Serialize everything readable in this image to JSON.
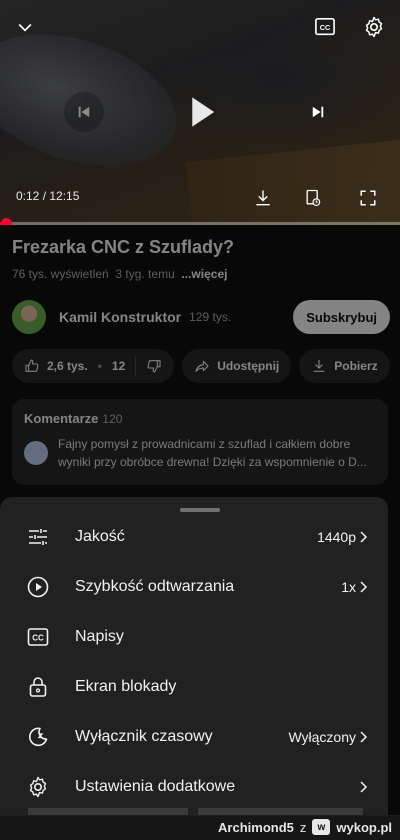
{
  "player": {
    "time_current": "0:12",
    "time_total": "12:15",
    "time_separator": " / ",
    "progress_fraction": 0.016,
    "icons": {
      "collapse": "chevron-down-icon",
      "captions": "cc-icon",
      "settings": "gear-icon",
      "previous": "skip-previous-icon",
      "play": "play-icon",
      "next": "skip-next-icon",
      "download": "download-icon",
      "save": "save-playlist-icon",
      "fullscreen": "fullscreen-icon"
    },
    "accent_color": "#ff0033"
  },
  "video": {
    "title": "Frezarka CNC z Szuflady?",
    "views": "76 tys. wyświetleń",
    "age": "3 tyg. temu",
    "more_label": "...więcej"
  },
  "channel": {
    "name": "Kamil Konstruktor",
    "subscribers": "129 tys.",
    "subscribe_label": "Subskrybuj"
  },
  "actions": {
    "likes": "2,6 tys.",
    "dislike_count": "12",
    "share_label": "Udostępnij",
    "download_label": "Pobierz"
  },
  "comments": {
    "title": "Komentarze",
    "count": "120",
    "top_comment": "Fajny pomysł z prowadnicami z szuflad i całkiem dobre wyniki przy obróbce drewna! Dzięki za wspomnienie o D..."
  },
  "settings_sheet": {
    "items": [
      {
        "label": "Jakość",
        "value": "1440p",
        "icon": "sliders-icon"
      },
      {
        "label": "Szybkość odtwarzania",
        "value": "1x",
        "icon": "playback-speed-icon"
      },
      {
        "label": "Napisy",
        "value": "",
        "icon": "cc-icon"
      },
      {
        "label": "Ekran blokady",
        "value": "",
        "icon": "lock-icon"
      },
      {
        "label": "Wyłącznik czasowy",
        "value": "Wyłączony",
        "icon": "sleep-timer-icon"
      },
      {
        "label": "Ustawienia dodatkowe",
        "value": "",
        "icon": "gear-icon"
      }
    ]
  },
  "footer": {
    "author": "Archimond5",
    "z": "z",
    "site": "wykop.pl"
  }
}
